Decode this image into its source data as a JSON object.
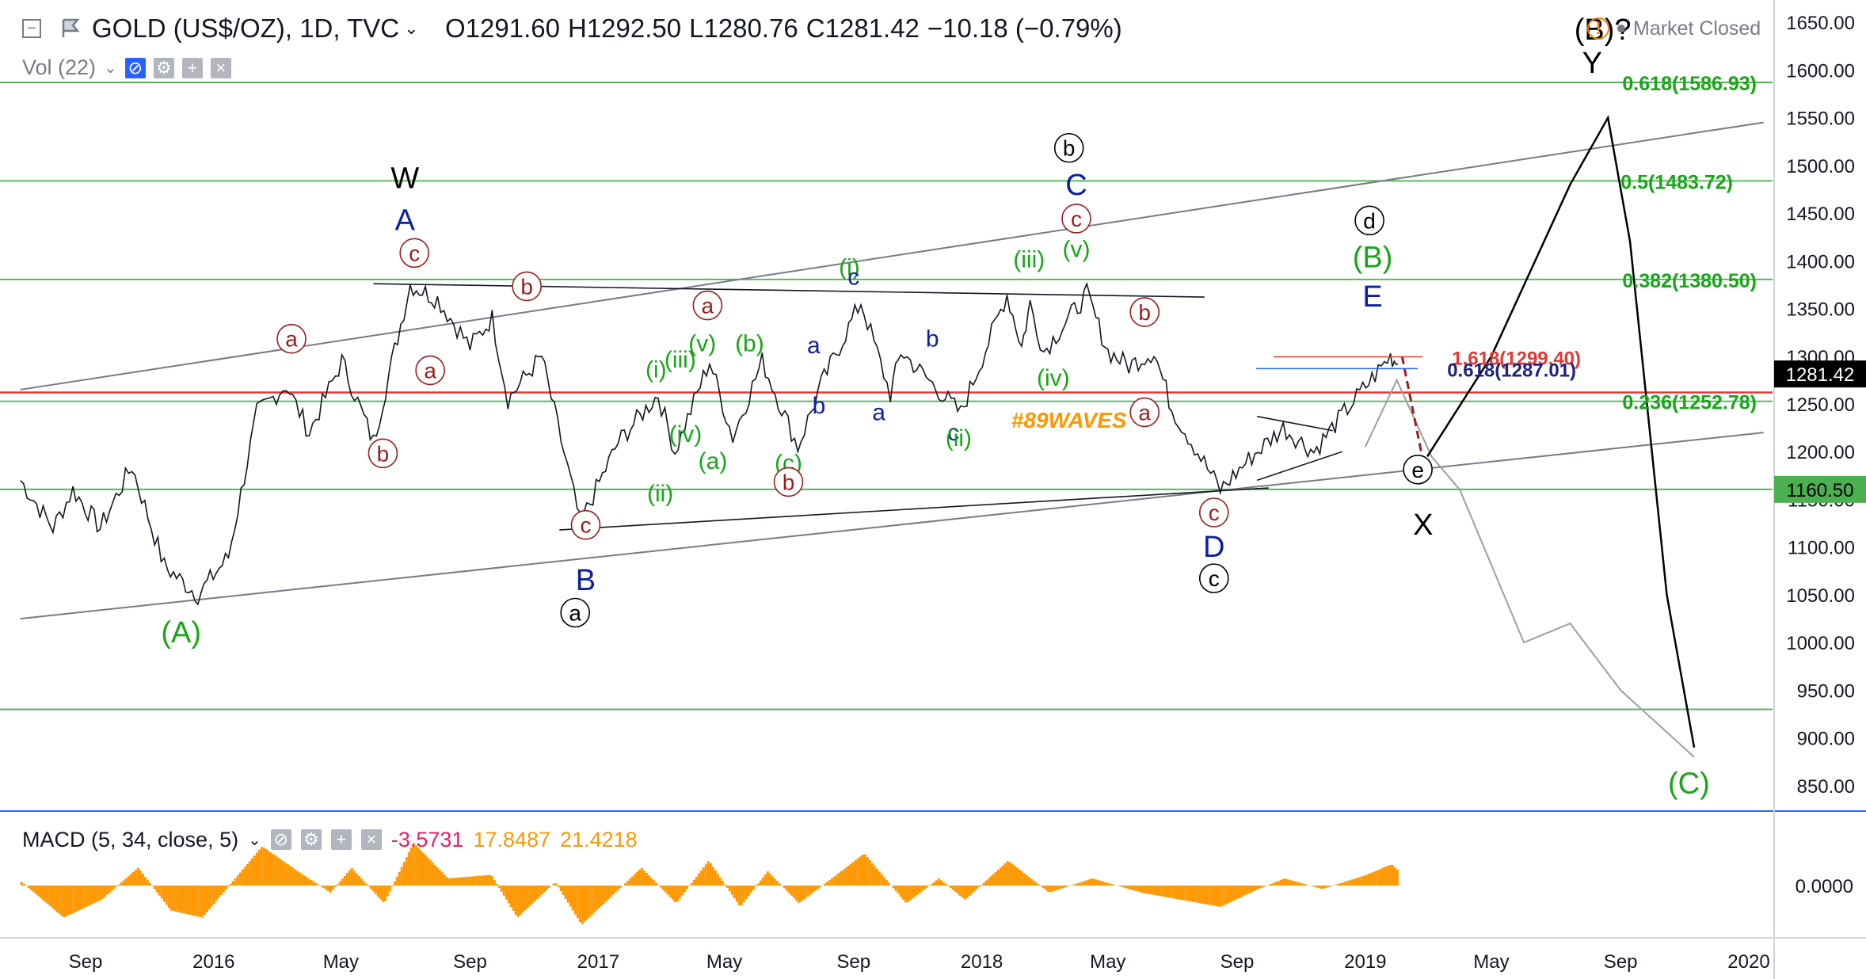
{
  "header": {
    "symbol": "GOLD (US$/OZ), 1D, TVC",
    "open_label": "O",
    "open": "1291.60",
    "high_label": "H",
    "high": "1292.50",
    "low_label": "L",
    "low": "1280.76",
    "close_label": "C",
    "close": "1281.42",
    "change": "−10.18 (−0.79%)",
    "market_status": "Market Closed",
    "volume_indicator": "Vol (22)"
  },
  "macd": {
    "name": "MACD (5, 34, close, 5)",
    "value1": "-3.5731",
    "value2": "17.8487",
    "value3": "21.4218",
    "zero_label": "0.0000",
    "colors": {
      "histogram": "#ff9800"
    }
  },
  "colors": {
    "price_line": "#131722",
    "fib_line": "#4caf50",
    "channel": "#787b86",
    "wave_green": "#17a617",
    "wave_blue": "#0d1fa0",
    "wave_red": "#9b1c1c",
    "accent_price": "#000000",
    "annotation_orange": "#ff9800"
  },
  "chart_data": {
    "type": "line",
    "title": "GOLD (US$/OZ), 1D, TVC",
    "x_tick_labels": [
      "Sep",
      "2016",
      "May",
      "Sep",
      "2017",
      "May",
      "Sep",
      "2018",
      "May",
      "Sep",
      "2019",
      "May",
      "Sep",
      "2020"
    ],
    "x_tick_dates": [
      "2015-09-01",
      "2016-01-01",
      "2016-05-01",
      "2016-09-01",
      "2017-01-01",
      "2017-05-01",
      "2017-09-01",
      "2018-01-01",
      "2018-05-01",
      "2018-09-01",
      "2019-01-01",
      "2019-05-01",
      "2019-09-01",
      "2020-01-01"
    ],
    "y_tick_labels": [
      "850.00",
      "900.00",
      "950.00",
      "1000.00",
      "1050.00",
      "1100.00",
      "1150.00",
      "1200.00",
      "1250.00",
      "1300.00",
      "1350.00",
      "1400.00",
      "1450.00",
      "1500.00",
      "1550.00",
      "1600.00",
      "1650.00"
    ],
    "ylim": [
      835,
      1665
    ],
    "last_price_label": "1281.42",
    "support_label": "1160.50",
    "series": [
      {
        "values_daily_close_approx": [
          [
            "2015-07-01",
            1170
          ],
          [
            "2015-08-01",
            1120
          ],
          [
            "2015-08-20",
            1160
          ],
          [
            "2015-09-15",
            1120
          ],
          [
            "2015-10-15",
            1185
          ],
          [
            "2015-11-15",
            1080
          ],
          [
            "2015-12-17",
            1050
          ],
          [
            "2016-01-15",
            1090
          ],
          [
            "2016-02-11",
            1240
          ],
          [
            "2016-03-10",
            1270
          ],
          [
            "2016-04-01",
            1220
          ],
          [
            "2016-05-02",
            1295
          ],
          [
            "2016-06-01",
            1210
          ],
          [
            "2016-06-24",
            1320
          ],
          [
            "2016-07-06",
            1375
          ],
          [
            "2016-08-01",
            1360
          ],
          [
            "2016-09-01",
            1310
          ],
          [
            "2016-09-22",
            1340
          ],
          [
            "2016-10-07",
            1255
          ],
          [
            "2016-11-08",
            1300
          ],
          [
            "2016-12-15",
            1125
          ],
          [
            "2017-01-20",
            1210
          ],
          [
            "2017-02-27",
            1260
          ],
          [
            "2017-03-15",
            1200
          ],
          [
            "2017-04-17",
            1295
          ],
          [
            "2017-05-09",
            1215
          ],
          [
            "2017-06-06",
            1295
          ],
          [
            "2017-07-10",
            1205
          ],
          [
            "2017-08-01",
            1270
          ],
          [
            "2017-09-08",
            1357
          ],
          [
            "2017-10-06",
            1260
          ],
          [
            "2017-10-16",
            1305
          ],
          [
            "2017-12-12",
            1240
          ],
          [
            "2018-01-25",
            1365
          ],
          [
            "2018-02-08",
            1310
          ],
          [
            "2018-02-16",
            1355
          ],
          [
            "2018-03-01",
            1305
          ],
          [
            "2018-04-11",
            1365
          ],
          [
            "2018-05-01",
            1305
          ],
          [
            "2018-05-21",
            1290
          ],
          [
            "2018-06-14",
            1305
          ],
          [
            "2018-07-01",
            1245
          ],
          [
            "2018-08-16",
            1160
          ],
          [
            "2018-09-15",
            1195
          ],
          [
            "2018-10-15",
            1225
          ],
          [
            "2018-11-13",
            1200
          ],
          [
            "2018-12-15",
            1245
          ],
          [
            "2019-01-25",
            1300
          ],
          [
            "2019-02-01",
            1292
          ]
        ]
      }
    ],
    "projections": {
      "main_path": [
        [
          "2019-02-05",
          1290
        ],
        [
          "2019-03-01",
          1195
        ],
        [
          "2019-05-01",
          1300
        ],
        [
          "2019-07-15",
          1480
        ],
        [
          "2019-08-20",
          1550
        ],
        [
          "2019-09-10",
          1420
        ],
        [
          "2019-10-15",
          1050
        ],
        [
          "2019-11-10",
          890
        ]
      ],
      "alt_path": [
        [
          "2019-01-01",
          1205
        ],
        [
          "2019-01-31",
          1275
        ],
        [
          "2019-03-05",
          1195
        ],
        [
          "2019-04-01",
          1160
        ],
        [
          "2019-06-01",
          1000
        ],
        [
          "2019-07-15",
          1020
        ],
        [
          "2019-09-01",
          950
        ],
        [
          "2019-11-10",
          880
        ]
      ]
    },
    "fib_levels": [
      {
        "label": "0.618(1586.93)",
        "value": 1586.93
      },
      {
        "label": "0.5(1483.72)",
        "value": 1483.72
      },
      {
        "label": "0.382(1380.50)",
        "value": 1380.5
      },
      {
        "label": "0.236(1252.78)",
        "value": 1252.78
      },
      {
        "label": "1.618(1299.40)",
        "value": 1299.4
      },
      {
        "label": "0.618(1287.01)",
        "value": 1287.01
      }
    ],
    "horizontal_lines": [
      1586.93,
      1483.72,
      1380.5,
      1262.0,
      1252.78,
      1160.5,
      930.0
    ],
    "channel": {
      "upper": [
        [
          "2015-07-01",
          1265
        ],
        [
          "2020-01-15",
          1545
        ]
      ],
      "lower": [
        [
          "2015-07-01",
          1025
        ],
        [
          "2020-01-15",
          1220
        ]
      ]
    },
    "wave_labels": [
      {
        "text": "(A)",
        "date": "2015-12-01",
        "value": 1000,
        "color": "green"
      },
      {
        "text": "W",
        "date": "2016-07-01",
        "value": 1476,
        "color": "black"
      },
      {
        "text": "A",
        "date": "2016-07-01",
        "value": 1432,
        "color": "blue"
      },
      {
        "text": "c",
        "date": "2016-07-10",
        "value": 1400,
        "color": "red",
        "circled": true
      },
      {
        "text": "a",
        "date": "2016-03-15",
        "value": 1310,
        "color": "red",
        "circled": true
      },
      {
        "text": "a",
        "date": "2016-07-25",
        "value": 1277,
        "color": "red",
        "circled": true
      },
      {
        "text": "b",
        "date": "2016-06-10",
        "value": 1190,
        "color": "red",
        "circled": true
      },
      {
        "text": "b",
        "date": "2016-10-25",
        "value": 1365,
        "color": "red",
        "circled": true
      },
      {
        "text": "c",
        "date": "2016-12-20",
        "value": 1115,
        "color": "red",
        "circled": true
      },
      {
        "text": "B",
        "date": "2016-12-20",
        "value": 1055,
        "color": "blue"
      },
      {
        "text": "a",
        "date": "2016-12-10",
        "value": 1023,
        "color": "black",
        "circled": true
      },
      {
        "text": "(i)",
        "date": "2017-02-25",
        "value": 1278,
        "color": "green"
      },
      {
        "text": "(ii)",
        "date": "2017-03-01",
        "value": 1148,
        "color": "green"
      },
      {
        "text": "(iii)",
        "date": "2017-03-20",
        "value": 1288,
        "color": "green"
      },
      {
        "text": "(iv)",
        "date": "2017-03-25",
        "value": 1210,
        "color": "green"
      },
      {
        "text": "(v)",
        "date": "2017-04-10",
        "value": 1305,
        "color": "green"
      },
      {
        "text": "a",
        "date": "2017-04-15",
        "value": 1345,
        "color": "red",
        "circled": true
      },
      {
        "text": "(a)",
        "date": "2017-04-20",
        "value": 1182,
        "color": "green"
      },
      {
        "text": "(b)",
        "date": "2017-05-25",
        "value": 1305,
        "color": "green"
      },
      {
        "text": "(c)",
        "date": "2017-07-01",
        "value": 1180,
        "color": "green"
      },
      {
        "text": "b",
        "date": "2017-07-01",
        "value": 1160,
        "color": "red",
        "circled": true
      },
      {
        "text": "a",
        "date": "2017-07-25",
        "value": 1303,
        "color": "blue"
      },
      {
        "text": "b",
        "date": "2017-07-30",
        "value": 1240,
        "color": "blue"
      },
      {
        "text": "(i)",
        "date": "2017-08-28",
        "value": 1385,
        "color": "green"
      },
      {
        "text": "c",
        "date": "2017-09-01",
        "value": 1375,
        "color": "blue"
      },
      {
        "text": "a",
        "date": "2017-09-25",
        "value": 1233,
        "color": "blue"
      },
      {
        "text": "b",
        "date": "2017-11-15",
        "value": 1310,
        "color": "blue"
      },
      {
        "text": "c",
        "date": "2017-12-05",
        "value": 1212,
        "color": "blue"
      },
      {
        "text": "(ii)",
        "date": "2017-12-10",
        "value": 1206,
        "color": "green"
      },
      {
        "text": "#89WAVES",
        "date": "2018-03-25",
        "value": 1225,
        "color": "orange"
      },
      {
        "text": "(iii)",
        "date": "2018-02-15",
        "value": 1393,
        "color": "green"
      },
      {
        "text": "(iv)",
        "date": "2018-03-10",
        "value": 1269,
        "color": "green"
      },
      {
        "text": "(v)",
        "date": "2018-04-01",
        "value": 1404,
        "color": "green"
      },
      {
        "text": "c",
        "date": "2018-04-01",
        "value": 1436,
        "color": "red",
        "circled": true
      },
      {
        "text": "C",
        "date": "2018-04-01",
        "value": 1469,
        "color": "blue"
      },
      {
        "text": "b",
        "date": "2018-03-25",
        "value": 1510,
        "color": "black",
        "circled": true
      },
      {
        "text": "b",
        "date": "2018-06-05",
        "value": 1338,
        "color": "red",
        "circled": true
      },
      {
        "text": "a",
        "date": "2018-06-05",
        "value": 1233,
        "color": "red",
        "circled": true
      },
      {
        "text": "c",
        "date": "2018-08-10",
        "value": 1128,
        "color": "red",
        "circled": true
      },
      {
        "text": "D",
        "date": "2018-08-10",
        "value": 1090,
        "color": "blue"
      },
      {
        "text": "c",
        "date": "2018-08-10",
        "value": 1059,
        "color": "black",
        "circled": true
      },
      {
        "text": "d",
        "date": "2019-01-05",
        "value": 1434,
        "color": "black",
        "circled": true
      },
      {
        "text": "(B)",
        "date": "2019-01-08",
        "value": 1393,
        "color": "green"
      },
      {
        "text": "E",
        "date": "2019-01-08",
        "value": 1352,
        "color": "blue"
      },
      {
        "text": "e",
        "date": "2019-02-20",
        "value": 1173,
        "color": "black",
        "circled": true
      },
      {
        "text": "X",
        "date": "2019-02-25",
        "value": 1113,
        "color": "black"
      },
      {
        "text": "(B)?",
        "date": "2019-08-15",
        "value": 1632,
        "color": "black"
      },
      {
        "text": "Y",
        "date": "2019-08-05",
        "value": 1597,
        "color": "black"
      },
      {
        "text": "(C)",
        "date": "2019-11-05",
        "value": 842,
        "color": "green"
      }
    ],
    "macd_histogram_note": "MACD histogram values approximate, oscillating around 0 between about -60 and +70"
  }
}
